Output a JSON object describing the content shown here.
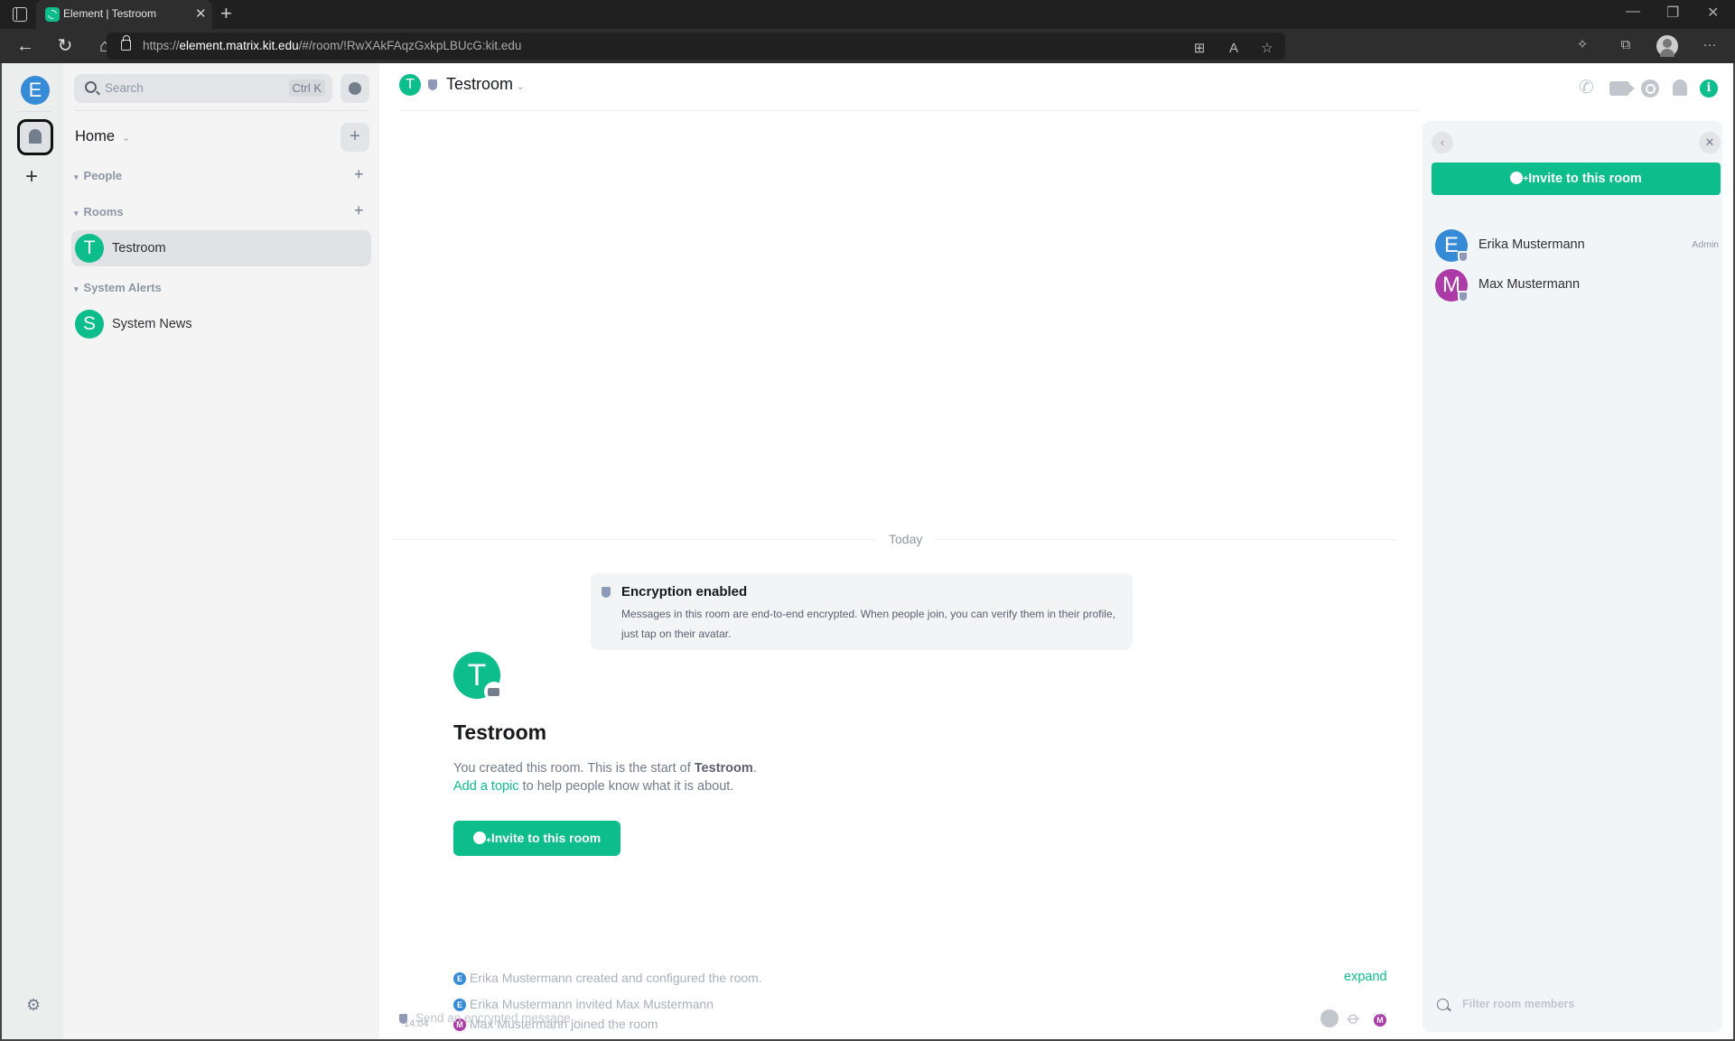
{
  "browser": {
    "tab_title": "Element | Testroom",
    "url_prefix": "https://",
    "url_host": "element.matrix.kit.edu",
    "url_path": "/#/room/!RwXAkFAqzGxkpLBUcG:kit.edu",
    "icons": [
      "tab-actions-icon",
      "favicon-element",
      "close-tab-icon",
      "new-tab-icon",
      "back-icon",
      "refresh-icon",
      "home-icon",
      "lock-icon",
      "app-available-icon",
      "read-aloud-icon",
      "add-favorite-icon",
      "extensions-icon",
      "collections-icon",
      "profile-icon",
      "more-icon",
      "minimize-icon",
      "restore-icon",
      "close-window-icon"
    ]
  },
  "spaces": {
    "user_initial": "E",
    "add_label": "+"
  },
  "roomlist": {
    "search_placeholder": "Search",
    "search_shortcut": "Ctrl K",
    "home_label": "Home",
    "sections": [
      {
        "label": "People"
      },
      {
        "label": "Rooms",
        "rooms": [
          {
            "initial": "T",
            "name": "Testroom",
            "active": true
          }
        ]
      },
      {
        "label": "System Alerts",
        "rooms": [
          {
            "initial": "S",
            "name": "System News"
          }
        ]
      }
    ]
  },
  "room_header": {
    "initial": "T",
    "name": "Testroom"
  },
  "timeline": {
    "date_label": "Today",
    "encryption": {
      "title": "Encryption enabled",
      "body": "Messages in this room are end-to-end encrypted. When people join, you can verify them in their profile, just tap on their avatar."
    },
    "intro": {
      "initial": "T",
      "title": "Testroom",
      "line1_prefix": "You created this room. This is the start of ",
      "line1_bold": "Testroom",
      "line1_suffix": ".",
      "topic_link": "Add a topic",
      "line2_suffix": " to help people know what it is about.",
      "invite_label": "Invite to this room"
    },
    "events": [
      {
        "initial": "E",
        "color": "#368bd6",
        "text": "Erika Mustermann created and configured the room."
      },
      {
        "initial": "E",
        "color": "#368bd6",
        "text": "Erika Mustermann invited Max Mustermann"
      },
      {
        "initial": "M",
        "color": "#ac3ba8",
        "text": "Max Mustermann joined the room",
        "time": "14:04"
      }
    ],
    "expand_label": "expand",
    "read_receipt_initial": "M"
  },
  "composer": {
    "placeholder": "Send an encrypted message..."
  },
  "right_panel": {
    "invite_label": "Invite to this room",
    "members": [
      {
        "initial": "E",
        "name": "Erika Mustermann",
        "role": "Admin",
        "color": "#368bd6"
      },
      {
        "initial": "M",
        "name": "Max Mustermann",
        "role": "",
        "color": "#ac3ba8"
      }
    ],
    "filter_placeholder": "Filter room members"
  },
  "colors": {
    "accent": "#0dbd8b",
    "erika": "#368bd6",
    "max": "#ac3ba8"
  }
}
